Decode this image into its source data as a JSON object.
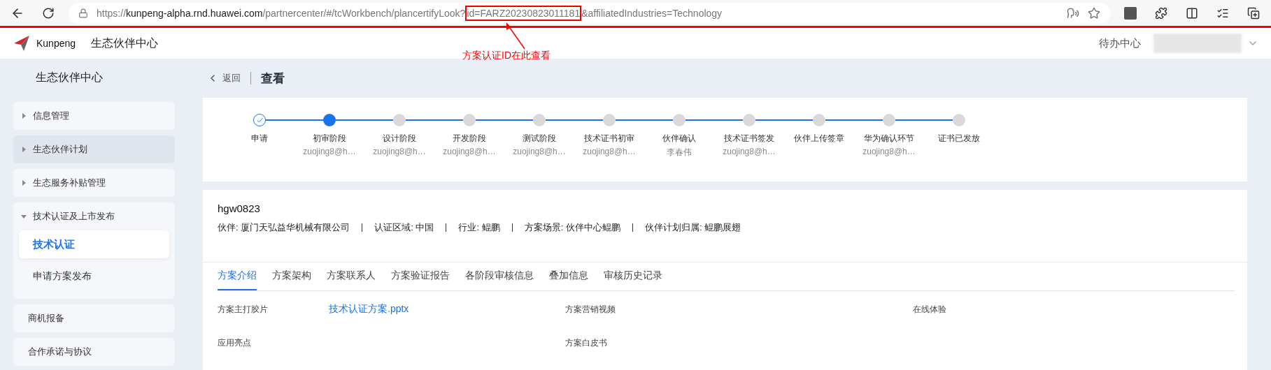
{
  "browser": {
    "url": {
      "scheme": "https://",
      "host": "kunpeng-alpha.rnd.huawei.com",
      "path": "/partnercenter/#/tcWorkbench/plancertifyLook?",
      "highlighted": "id=FARZ20230823011181",
      "rest": "&affiliatedIndustries=Technology"
    }
  },
  "annotation": {
    "note": "方案认证ID在此查看"
  },
  "header": {
    "logo": "Kunpeng",
    "title": "生态伙伴中心",
    "todo": "待办中心"
  },
  "sidebar": {
    "title": "生态伙伴中心",
    "items": [
      {
        "kind": "group",
        "label": "信息管理",
        "expanded": false,
        "hovered": false
      },
      {
        "kind": "group",
        "label": "生态伙伴计划",
        "expanded": false,
        "hovered": true
      },
      {
        "kind": "group",
        "label": "生态服务补贴管理",
        "expanded": false,
        "hovered": false
      },
      {
        "kind": "group",
        "label": "技术认证及上市发布",
        "expanded": true,
        "hovered": false,
        "children": [
          {
            "label": "技术认证",
            "selected": true
          },
          {
            "label": "申请方案发布",
            "selected": false
          }
        ]
      },
      {
        "kind": "link",
        "label": "商机报备",
        "hovered": false
      },
      {
        "kind": "link",
        "label": "合作承诺与协议",
        "hovered": false
      }
    ]
  },
  "page": {
    "back": "返回",
    "title": "查看"
  },
  "steps": [
    {
      "label": "申请",
      "done": true,
      "current": false
    },
    {
      "label": "初审阶段",
      "sub": "zuojing8@h…",
      "done": false,
      "current": true
    },
    {
      "label": "设计阶段",
      "sub": "zuojing8@h…",
      "done": false,
      "current": false
    },
    {
      "label": "开发阶段",
      "sub": "zuojing8@h…",
      "done": false,
      "current": false
    },
    {
      "label": "测试阶段",
      "sub": "zuojing8@h…",
      "done": false,
      "current": false
    },
    {
      "label": "技术证书初审",
      "sub": "zuojing8@h…",
      "done": false,
      "current": false
    },
    {
      "label": "伙伴确认",
      "sub": "李春伟",
      "done": false,
      "current": false
    },
    {
      "label": "技术证书签发",
      "sub": "zuojing8@h…",
      "done": false,
      "current": false
    },
    {
      "label": "伙伴上传签章",
      "done": false,
      "current": false
    },
    {
      "label": "华为确认环节",
      "sub": "zuojing8@h…",
      "done": false,
      "current": false
    },
    {
      "label": "证书已发放",
      "done": false,
      "current": false
    }
  ],
  "solution": {
    "name": "hgw0823",
    "meta": [
      "伙伴: 厦门天弘益华机械有限公司",
      "认证区域: 中国",
      "行业: 鲲鹏",
      "方案场景: 伙伴中心鲲鹏",
      "伙伴计划归属: 鲲鹏展翅"
    ]
  },
  "tabs": [
    {
      "label": "方案介绍",
      "selected": true
    },
    {
      "label": "方案架构",
      "selected": false
    },
    {
      "label": "方案联系人",
      "selected": false
    },
    {
      "label": "方案验证报告",
      "selected": false
    },
    {
      "label": "各阶段审核信息",
      "selected": false
    },
    {
      "label": "叠加信息",
      "selected": false
    },
    {
      "label": "审核历史记录",
      "selected": false
    }
  ],
  "fields": [
    {
      "label": "方案主打胶片",
      "value": "技术认证方案.pptx"
    },
    {
      "label": "方案营销视频"
    },
    {
      "label": "在线体验"
    },
    {
      "label": "应用亮点"
    },
    {
      "label": "方案白皮书"
    }
  ]
}
